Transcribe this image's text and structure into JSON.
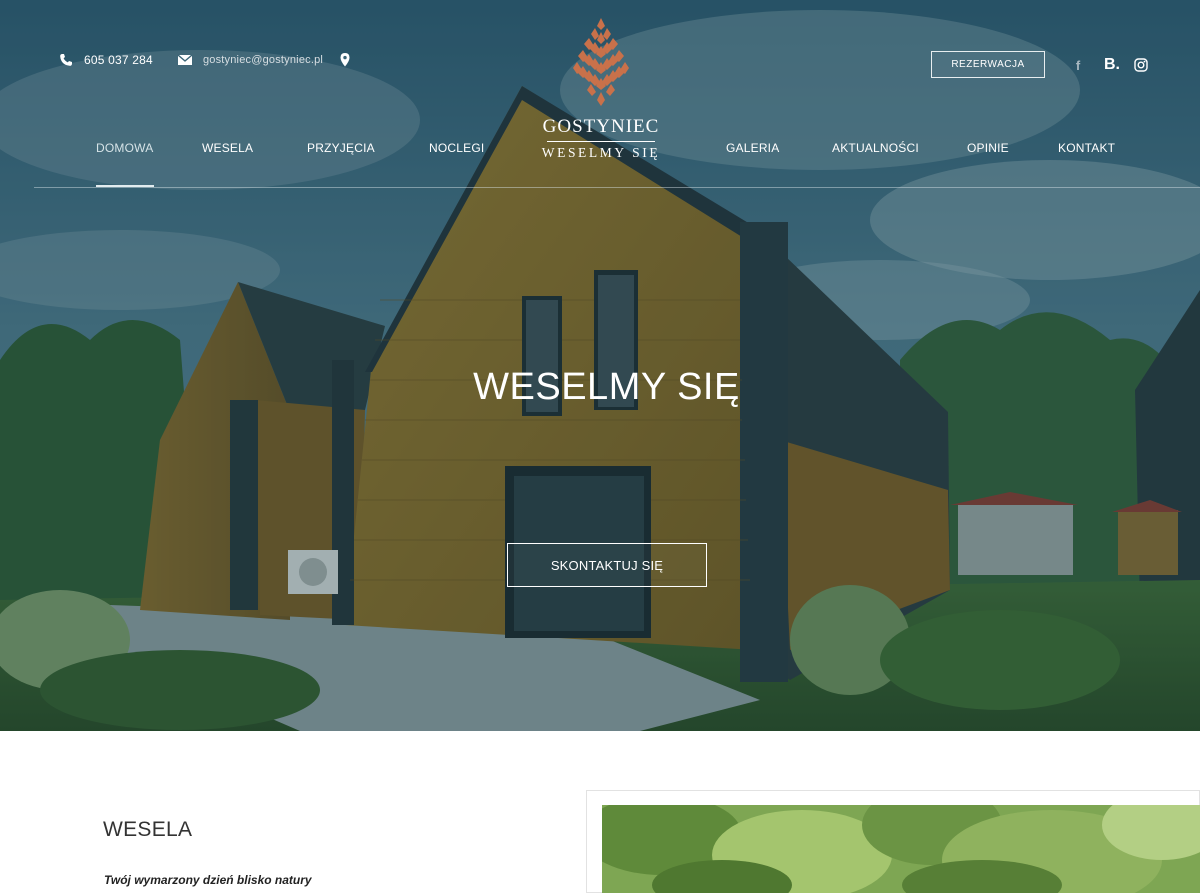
{
  "topbar": {
    "phone": "605 037 284",
    "email": "gostyniec@gostyniec.pl"
  },
  "logo": {
    "brand": "GOSTYNIEC",
    "tagline": "WESELMY SIĘ",
    "cone_color": "#c9714a"
  },
  "reserve_label": "REZERWACJA",
  "social": {
    "facebook": "f",
    "booking": "B."
  },
  "nav": {
    "items": [
      {
        "label": "DOMOWA"
      },
      {
        "label": "WESELA"
      },
      {
        "label": "PRZYJĘCIA"
      },
      {
        "label": "NOCLEGI"
      },
      {
        "label": "GALERIA"
      },
      {
        "label": "AKTUALNOŚCI"
      },
      {
        "label": "OPINIE"
      },
      {
        "label": "KONTAKT"
      }
    ],
    "active_index": 0
  },
  "hero": {
    "title": "WESELMY SIĘ",
    "cta_label": "SKONTAKTUJ SIĘ"
  },
  "section": {
    "heading": "WESELA",
    "subheading": "Twój wymarzony dzień blisko natury"
  },
  "colors": {
    "accent": "#c9714a",
    "overlay": "#2c5a6a",
    "heading": "#333333"
  }
}
